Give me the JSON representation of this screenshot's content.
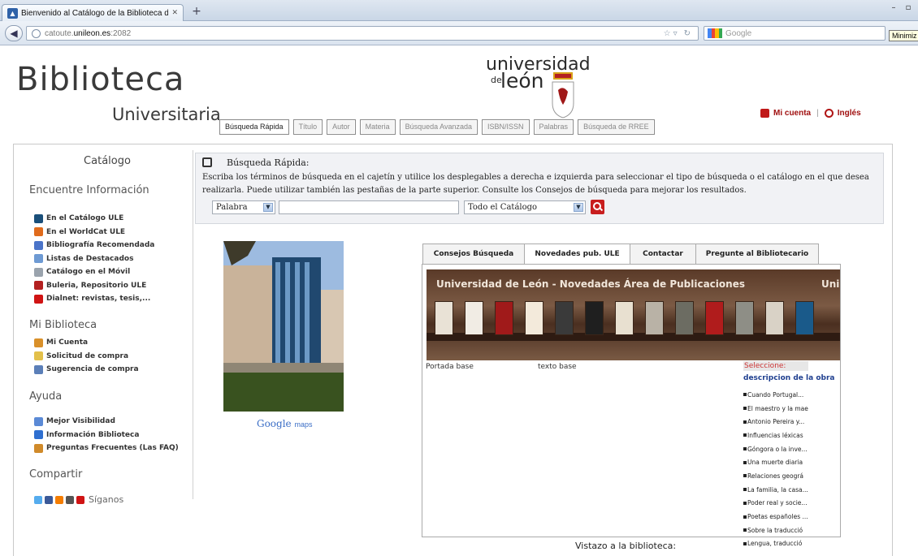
{
  "browser": {
    "tab_title": "Bienvenido al Catálogo de la Biblioteca de la ...",
    "new_tab_label": "+",
    "url_scheme": "catoute.",
    "url_host": "unileon.es",
    "url_port": ":2082",
    "search_placeholder": "Google",
    "tooltip": "Minimiz",
    "window_minimize": "–",
    "window_restore": "▫"
  },
  "header": {
    "brand_line1": "Biblioteca",
    "brand_line2": "Universitaria",
    "logo_line1": "universidad",
    "logo_de": "de",
    "logo_line2": "león",
    "my_account": "Mi cuenta",
    "separator": "|",
    "english": "Inglés"
  },
  "nav_tabs": [
    {
      "label": "Búsqueda Rápida",
      "active": true
    },
    {
      "label": "Título",
      "active": false
    },
    {
      "label": "Autor",
      "active": false
    },
    {
      "label": "Materia",
      "active": false
    },
    {
      "label": "Búsqueda Avanzada",
      "active": false
    },
    {
      "label": "ISBN/ISSN",
      "active": false
    },
    {
      "label": "Palabras",
      "active": false
    },
    {
      "label": "Búsqueda de RREE",
      "active": false
    }
  ],
  "sidebar": {
    "catalog_title": "Catálogo",
    "find_heading": "Encuentre Información",
    "find_items": [
      {
        "label": "En el Catálogo ULE",
        "icon": "catalog-icon",
        "color": "#1a4f7a"
      },
      {
        "label": "En el WorldCat ULE",
        "icon": "worldcat-icon",
        "color": "#e06b1c"
      },
      {
        "label": "Bibliografía Recomendada",
        "icon": "bibliography-icon",
        "color": "#4b74c9"
      },
      {
        "label": "Listas de Destacados",
        "icon": "list-icon",
        "color": "#6e9ad3"
      },
      {
        "label": "Catálogo en el Móvil",
        "icon": "mobile-icon",
        "color": "#9aa3ad"
      },
      {
        "label": "Buleria, Repositorio ULE",
        "icon": "repository-icon",
        "color": "#b32020"
      },
      {
        "label": "Dialnet: revistas, tesis,...",
        "icon": "dialnet-icon",
        "color": "#d01414"
      }
    ],
    "library_heading": "Mi Biblioteca",
    "library_items": [
      {
        "label": "Mi Cuenta",
        "icon": "user-icon",
        "color": "#d9902a"
      },
      {
        "label": "Solicitud de compra",
        "icon": "purchase-icon",
        "color": "#e3c04a"
      },
      {
        "label": "Sugerencia de compra",
        "icon": "suggestion-icon",
        "color": "#5b7fb8"
      }
    ],
    "help_heading": "Ayuda",
    "help_items": [
      {
        "label": "Mejor Visibilidad",
        "icon": "visibility-icon",
        "color": "#5b8ad6"
      },
      {
        "label": "Información Biblioteca",
        "icon": "info-icon",
        "color": "#2f6fd0"
      },
      {
        "label": "Preguntas Frecuentes (Las FAQ)",
        "icon": "faq-icon",
        "color": "#d08a2a"
      }
    ],
    "share_heading": "Compartir",
    "share_text": "Síganos",
    "share_icons": [
      {
        "name": "twitter-icon",
        "color": "#55acee"
      },
      {
        "name": "facebook-icon",
        "color": "#3b5998"
      },
      {
        "name": "blogger-icon",
        "color": "#f57d00"
      },
      {
        "name": "netvibes-icon",
        "color": "#555555"
      },
      {
        "name": "youtube-icon",
        "color": "#d01414"
      }
    ]
  },
  "search": {
    "title": "Búsqueda Rápida:",
    "description": "Escriba los términos de búsqueda en el cajetín y utilice los desplegables a derecha e izquierda para seleccionar el tipo de búsqueda o el catálogo en el que desea realizarla. Puede utilizar también las pestañas de la parte superior. Consulte los Consejos de búsqueda para mejorar los resultados.",
    "type_value": "Palabra",
    "query_value": "",
    "catalog_value": "Todo el Catálogo"
  },
  "photo": {
    "caption_brand": "Google",
    "caption_product": "maps"
  },
  "content_tabs": [
    {
      "label": "Consejos Búsqueda",
      "active": false
    },
    {
      "label": "Novedades pub. ULE",
      "active": true
    },
    {
      "label": "Contactar",
      "active": false
    },
    {
      "label": "Pregunte al Bibliotecario",
      "active": false
    }
  ],
  "novedades": {
    "banner_title": "Universidad de León - Novedades Área de Publicaciones",
    "banner_title_overflow": "Uni",
    "cover_label": "Portada base",
    "text_label": "texto base",
    "select_label": "Seleccione:",
    "description_heading": "descripcion de la obra",
    "works": [
      "Cuando Portugal...",
      "El maestro y la mae",
      "Antonio Pereira y...",
      "Influencias léxicas",
      "Góngora o la inve...",
      "Una muerte diaria",
      "Relaciones geográ",
      "La familia, la casa...",
      "Poder real y socie...",
      "Poetas españoles ...",
      "Sobre la traducció",
      "Lengua, traducció"
    ],
    "book_colors": [
      "#e9e2d6",
      "#f1ece4",
      "#a01a1a",
      "#f3eadb",
      "#3a3a3a",
      "#1f1f1f",
      "#e8e0d0",
      "#b9b2a6",
      "#6c6c62",
      "#b01c1c",
      "#8e8e86",
      "#d9d2c6",
      "#1a5a8a"
    ]
  },
  "footer": {
    "vistazo": "Vistazo a la biblioteca:"
  }
}
